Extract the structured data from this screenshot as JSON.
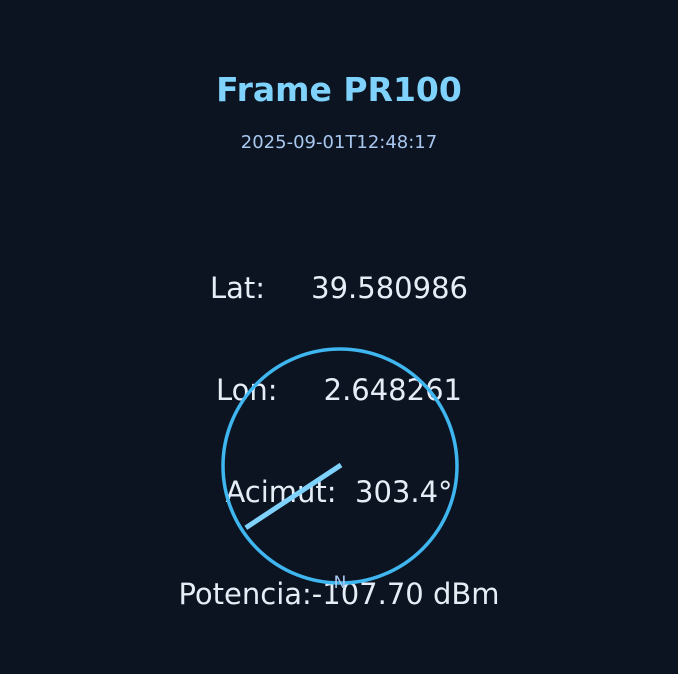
{
  "title": "Frame PR100",
  "timestamp": "2025-09-01T12:48:17",
  "readouts": {
    "lat": "Lat:     39.580986",
    "lon": "Lon:     2.648261",
    "azimuth": "Acimut:  303.4°",
    "power": "Potencia:-107.70 dBm"
  },
  "compass": {
    "north_label": "N",
    "azimuth_deg": 303.4,
    "ring_color": "#3fb6ef",
    "needle_color": "#7fd2fb"
  }
}
